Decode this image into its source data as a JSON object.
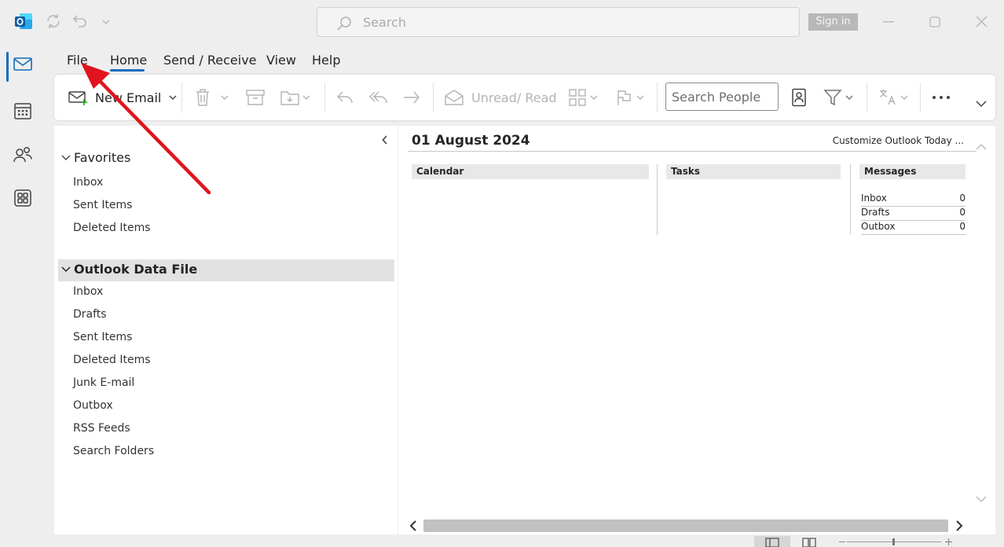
{
  "titlebar": {
    "search_placeholder": "Search",
    "signin_label": "Sign in"
  },
  "ribbon_tabs": [
    {
      "label": "File"
    },
    {
      "label": "Home"
    },
    {
      "label": "Send / Receive"
    },
    {
      "label": "View"
    },
    {
      "label": "Help"
    }
  ],
  "ribbon": {
    "new_email_label": "New Email",
    "unread_read_label": "Unread/ Read",
    "search_people_placeholder": "Search People"
  },
  "folder_pane": {
    "favorites_label": "Favorites",
    "favorites": [
      {
        "label": "Inbox"
      },
      {
        "label": "Sent Items"
      },
      {
        "label": "Deleted Items"
      }
    ],
    "data_file_label": "Outlook Data File",
    "data_file_folders": [
      {
        "label": "Inbox"
      },
      {
        "label": "Drafts"
      },
      {
        "label": "Sent Items"
      },
      {
        "label": "Deleted Items"
      },
      {
        "label": "Junk E-mail"
      },
      {
        "label": "Outbox"
      },
      {
        "label": "RSS Feeds"
      },
      {
        "label": "Search Folders"
      }
    ]
  },
  "outlook_today": {
    "date": "01 August 2024",
    "customize_label": "Customize Outlook Today ...",
    "calendar_label": "Calendar",
    "tasks_label": "Tasks",
    "messages_label": "Messages",
    "messages": [
      {
        "name": "Inbox",
        "count": "0"
      },
      {
        "name": "Drafts",
        "count": "0"
      },
      {
        "name": "Outbox",
        "count": "0"
      }
    ]
  },
  "colors": {
    "accent": "#0f6cbd",
    "arrow": "#e0141c"
  }
}
